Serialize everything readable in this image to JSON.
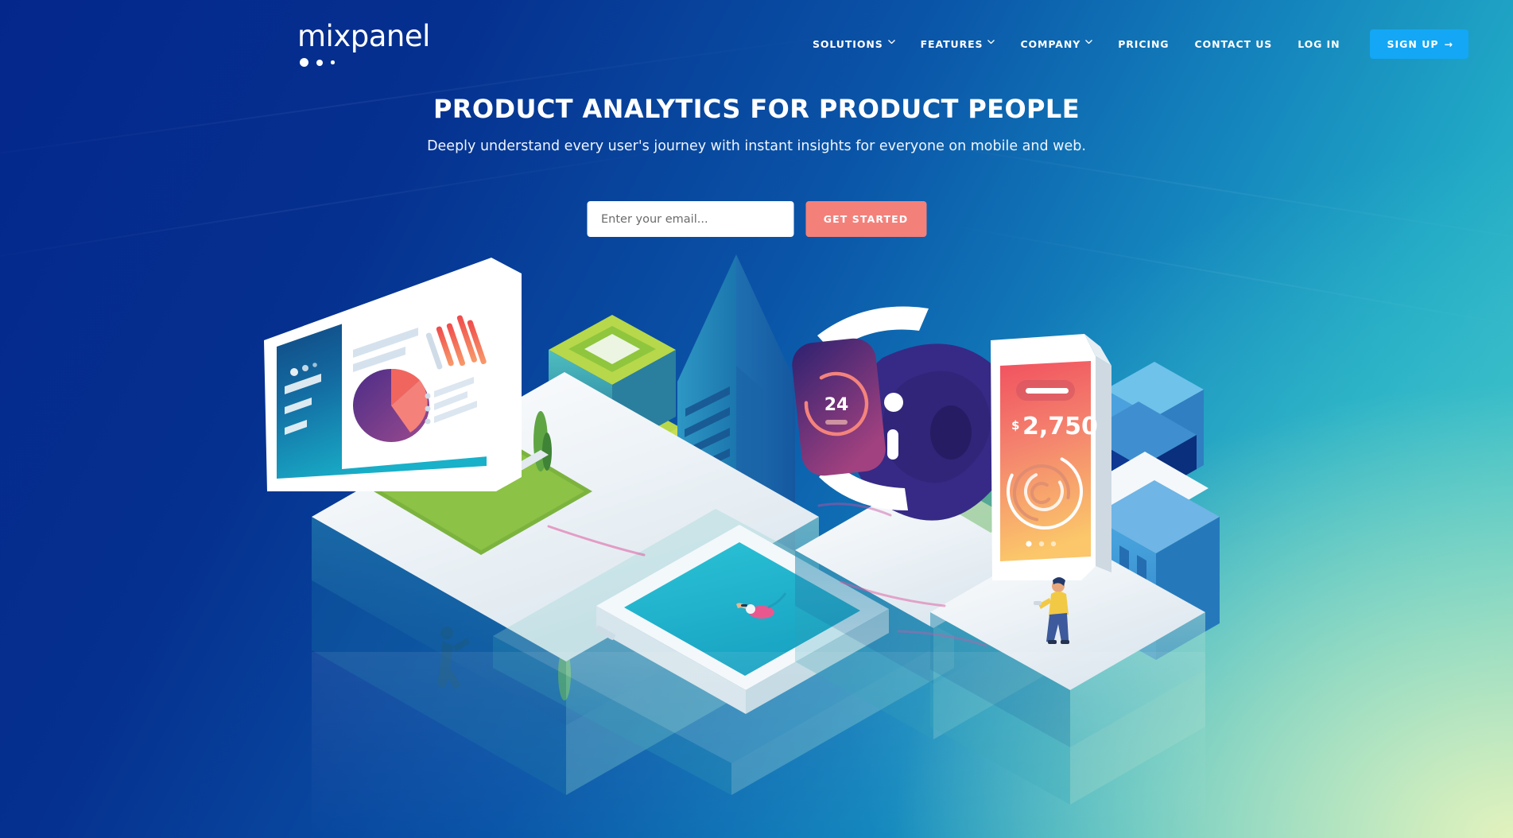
{
  "brand": {
    "logo_text": "mixpanel",
    "accent_blue": "#13a7f5",
    "accent_coral": "#f4807a",
    "navy": "#04278c"
  },
  "header": {
    "nav": [
      {
        "label": "SOLUTIONS",
        "has_caret": true
      },
      {
        "label": "FEATURES",
        "has_caret": true
      },
      {
        "label": "COMPANY",
        "has_caret": true
      },
      {
        "label": "PRICING",
        "has_caret": false
      },
      {
        "label": "CONTACT US",
        "has_caret": false
      },
      {
        "label": "LOG IN",
        "has_caret": false
      }
    ],
    "signup_label": "SIGN UP",
    "signup_arrow": "→"
  },
  "hero": {
    "title": "PRODUCT ANALYTICS FOR PRODUCT PEOPLE",
    "subtitle": "Deeply understand every user's journey with instant insights for everyone on mobile and web."
  },
  "form": {
    "email_placeholder": "Enter your email...",
    "email_value": "",
    "submit_label": "GET STARTED"
  },
  "illustration": {
    "description": "Isometric city scene with devices on platforms",
    "watch_value": "24",
    "phone_currency": "$",
    "phone_value": "2,750",
    "phone_dots": 3,
    "monitor_dots": 3
  }
}
